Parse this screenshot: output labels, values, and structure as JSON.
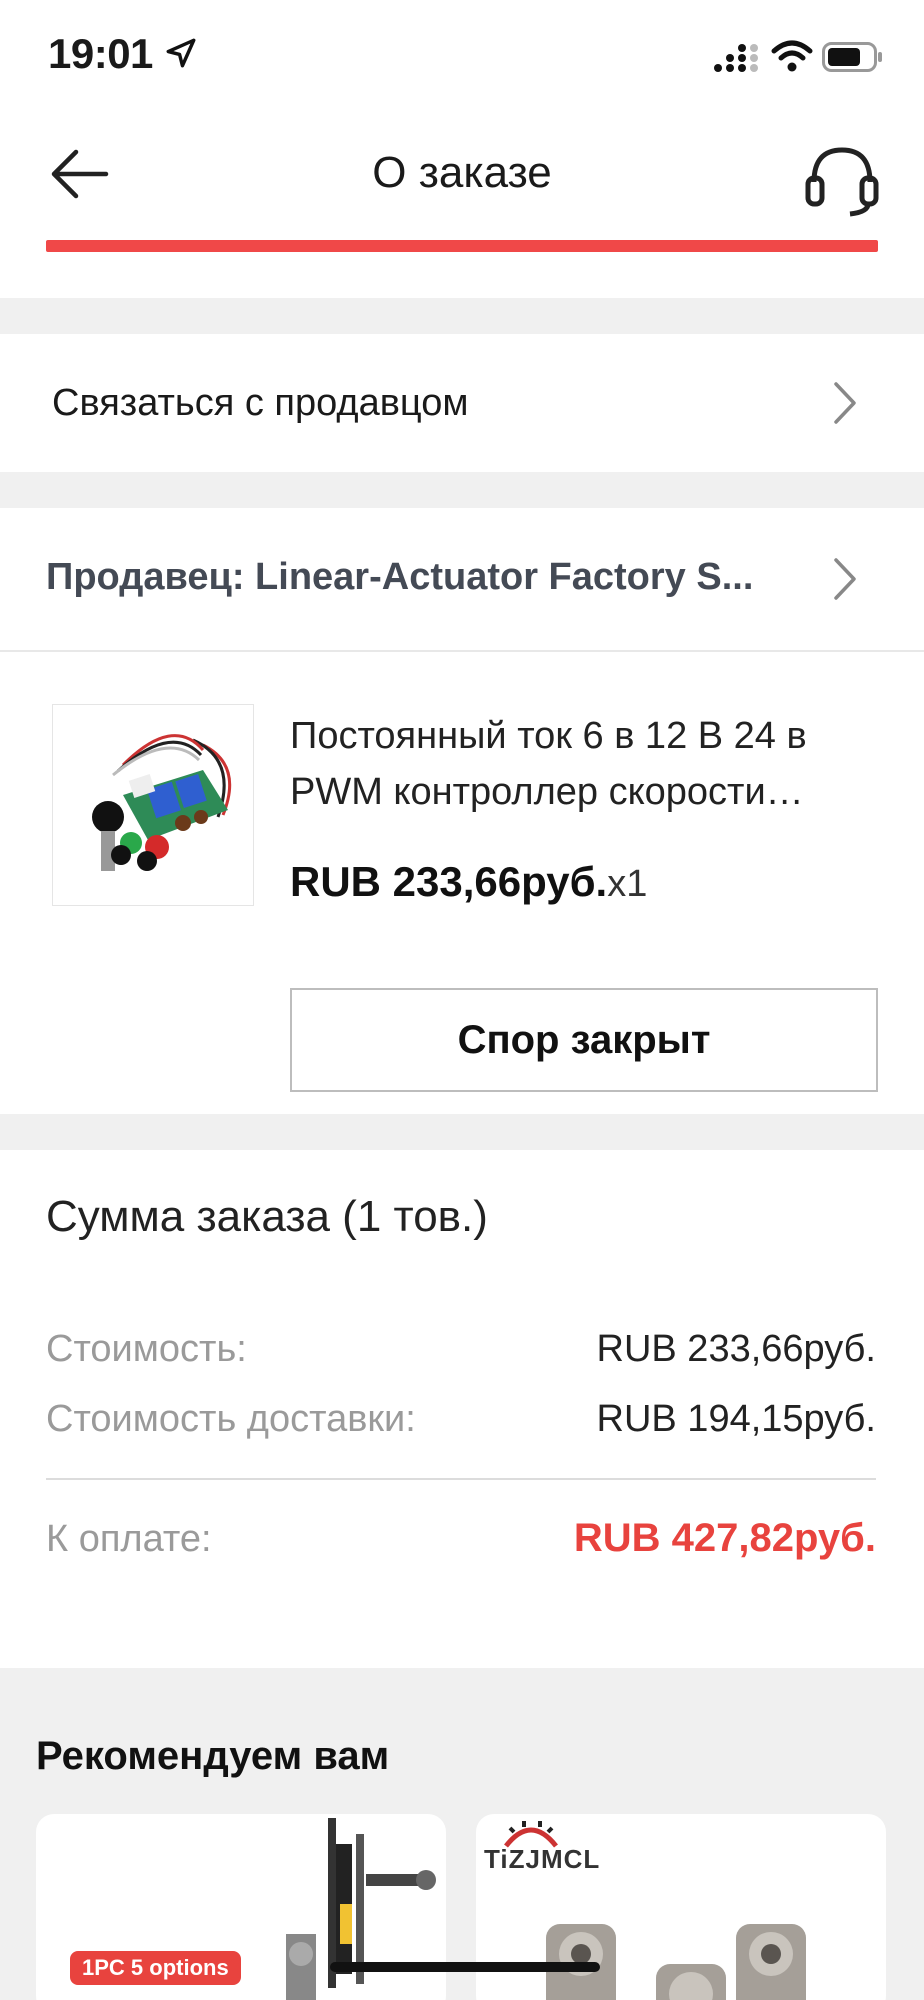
{
  "status_bar": {
    "time": "19:01",
    "icons": [
      "location-arrow-icon",
      "cellular-signal-icon",
      "wifi-icon",
      "battery-icon"
    ]
  },
  "header": {
    "title": "О заказе",
    "back_icon": "arrow-left-icon",
    "support_icon": "headset-icon",
    "accent_color": "#f04848"
  },
  "contact_seller": {
    "label": "Связаться с продавцом"
  },
  "seller": {
    "label": "Продавец: Linear-Actuator Factory S..."
  },
  "product": {
    "title": "Постоянный ток 6 в 12 В 24 в PWM контроллер скорости…",
    "price": "RUB 233,66руб.",
    "quantity": "x1",
    "dispute_button": "Спор закрыт"
  },
  "summary": {
    "title": "Сумма заказа (1 тов.)",
    "rows": [
      {
        "label": "Стоимость:",
        "value": "RUB 233,66руб."
      },
      {
        "label": "Стоимость доставки:",
        "value": "RUB 194,15руб."
      }
    ],
    "total_label": "К оплате:",
    "total_value": "RUB 427,82руб.",
    "total_color": "#e8433e"
  },
  "recommendations": {
    "title": "Рекомендуем вам",
    "cards": [
      {
        "badge": "1PC 5 options"
      },
      {
        "brand": "TiZJMCL"
      }
    ]
  }
}
